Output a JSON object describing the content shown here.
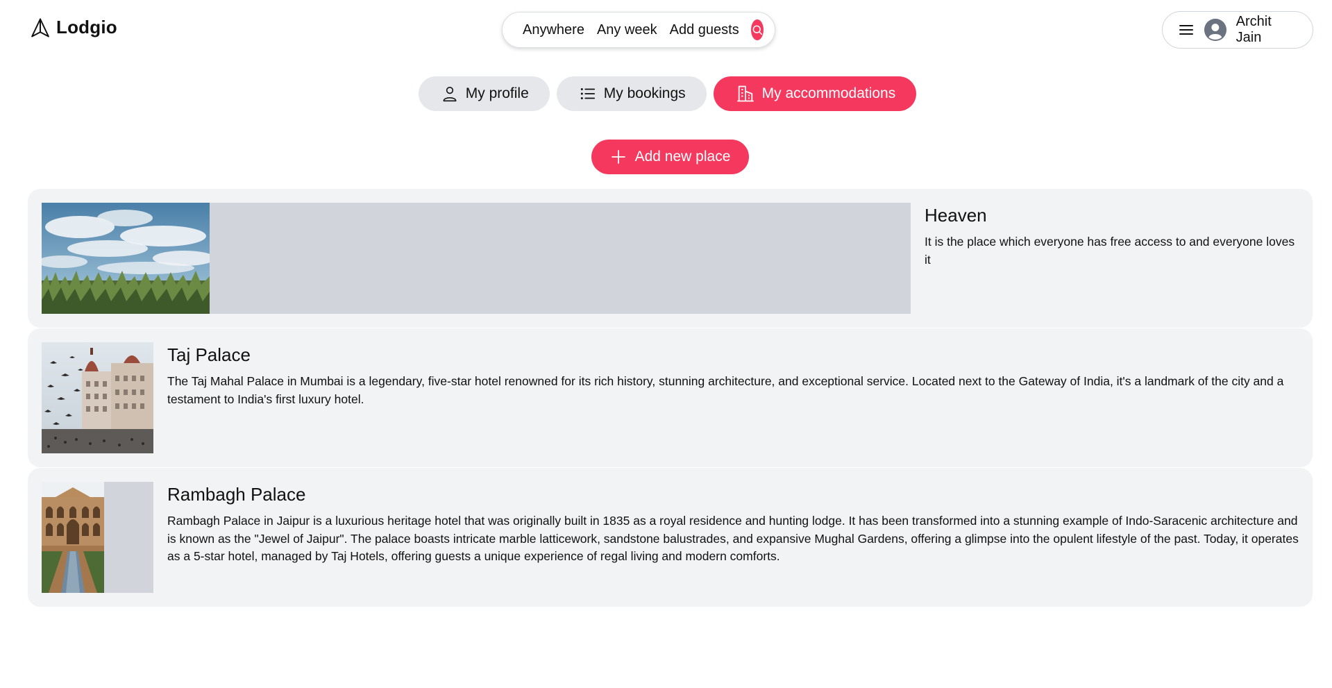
{
  "brand": {
    "name": "Lodgio",
    "icon": "paper-plane-icon",
    "accent": "#f5385d"
  },
  "search": {
    "where": "Anywhere",
    "when": "Any week",
    "who": "Add guests",
    "icon": "search-icon"
  },
  "user": {
    "name": "Archit Jain",
    "menu_icon": "hamburger-icon",
    "avatar_icon": "user-avatar-icon"
  },
  "tabs": [
    {
      "label": "My profile",
      "icon": "user-icon",
      "active": false
    },
    {
      "label": "My bookings",
      "icon": "list-icon",
      "active": false
    },
    {
      "label": "My accommodations",
      "icon": "building-icon",
      "active": true
    }
  ],
  "add_place": {
    "label": "Add new place",
    "icon": "plus-icon"
  },
  "places": [
    {
      "title": "Heaven",
      "description": "It is the place which everyone has free access to and everyone loves it",
      "photo": "sky-and-field-photo"
    },
    {
      "title": "Taj Palace",
      "description": "The Taj Mahal Palace in Mumbai is a legendary, five-star hotel renowned for its rich history, stunning architecture, and exceptional service. Located next to the Gateway of India, it's a landmark of the city and a testament to India's first luxury hotel.",
      "photo": "taj-palace-photo"
    },
    {
      "title": "Rambagh Palace",
      "description": "Rambagh Palace in Jaipur is a luxurious heritage hotel that was originally built in 1835 as a royal residence and hunting lodge. It has been transformed into a stunning example of Indo-Saracenic architecture and is known as the \"Jewel of Jaipur\". The palace boasts intricate marble latticework, sandstone balustrades, and expansive Mughal Gardens, offering a glimpse into the opulent lifestyle of the past. Today, it operates as a 5-star hotel, managed by Taj Hotels, offering guests a unique experience of regal living and modern comforts.",
      "photo": "palace-courtyard-photo"
    }
  ]
}
